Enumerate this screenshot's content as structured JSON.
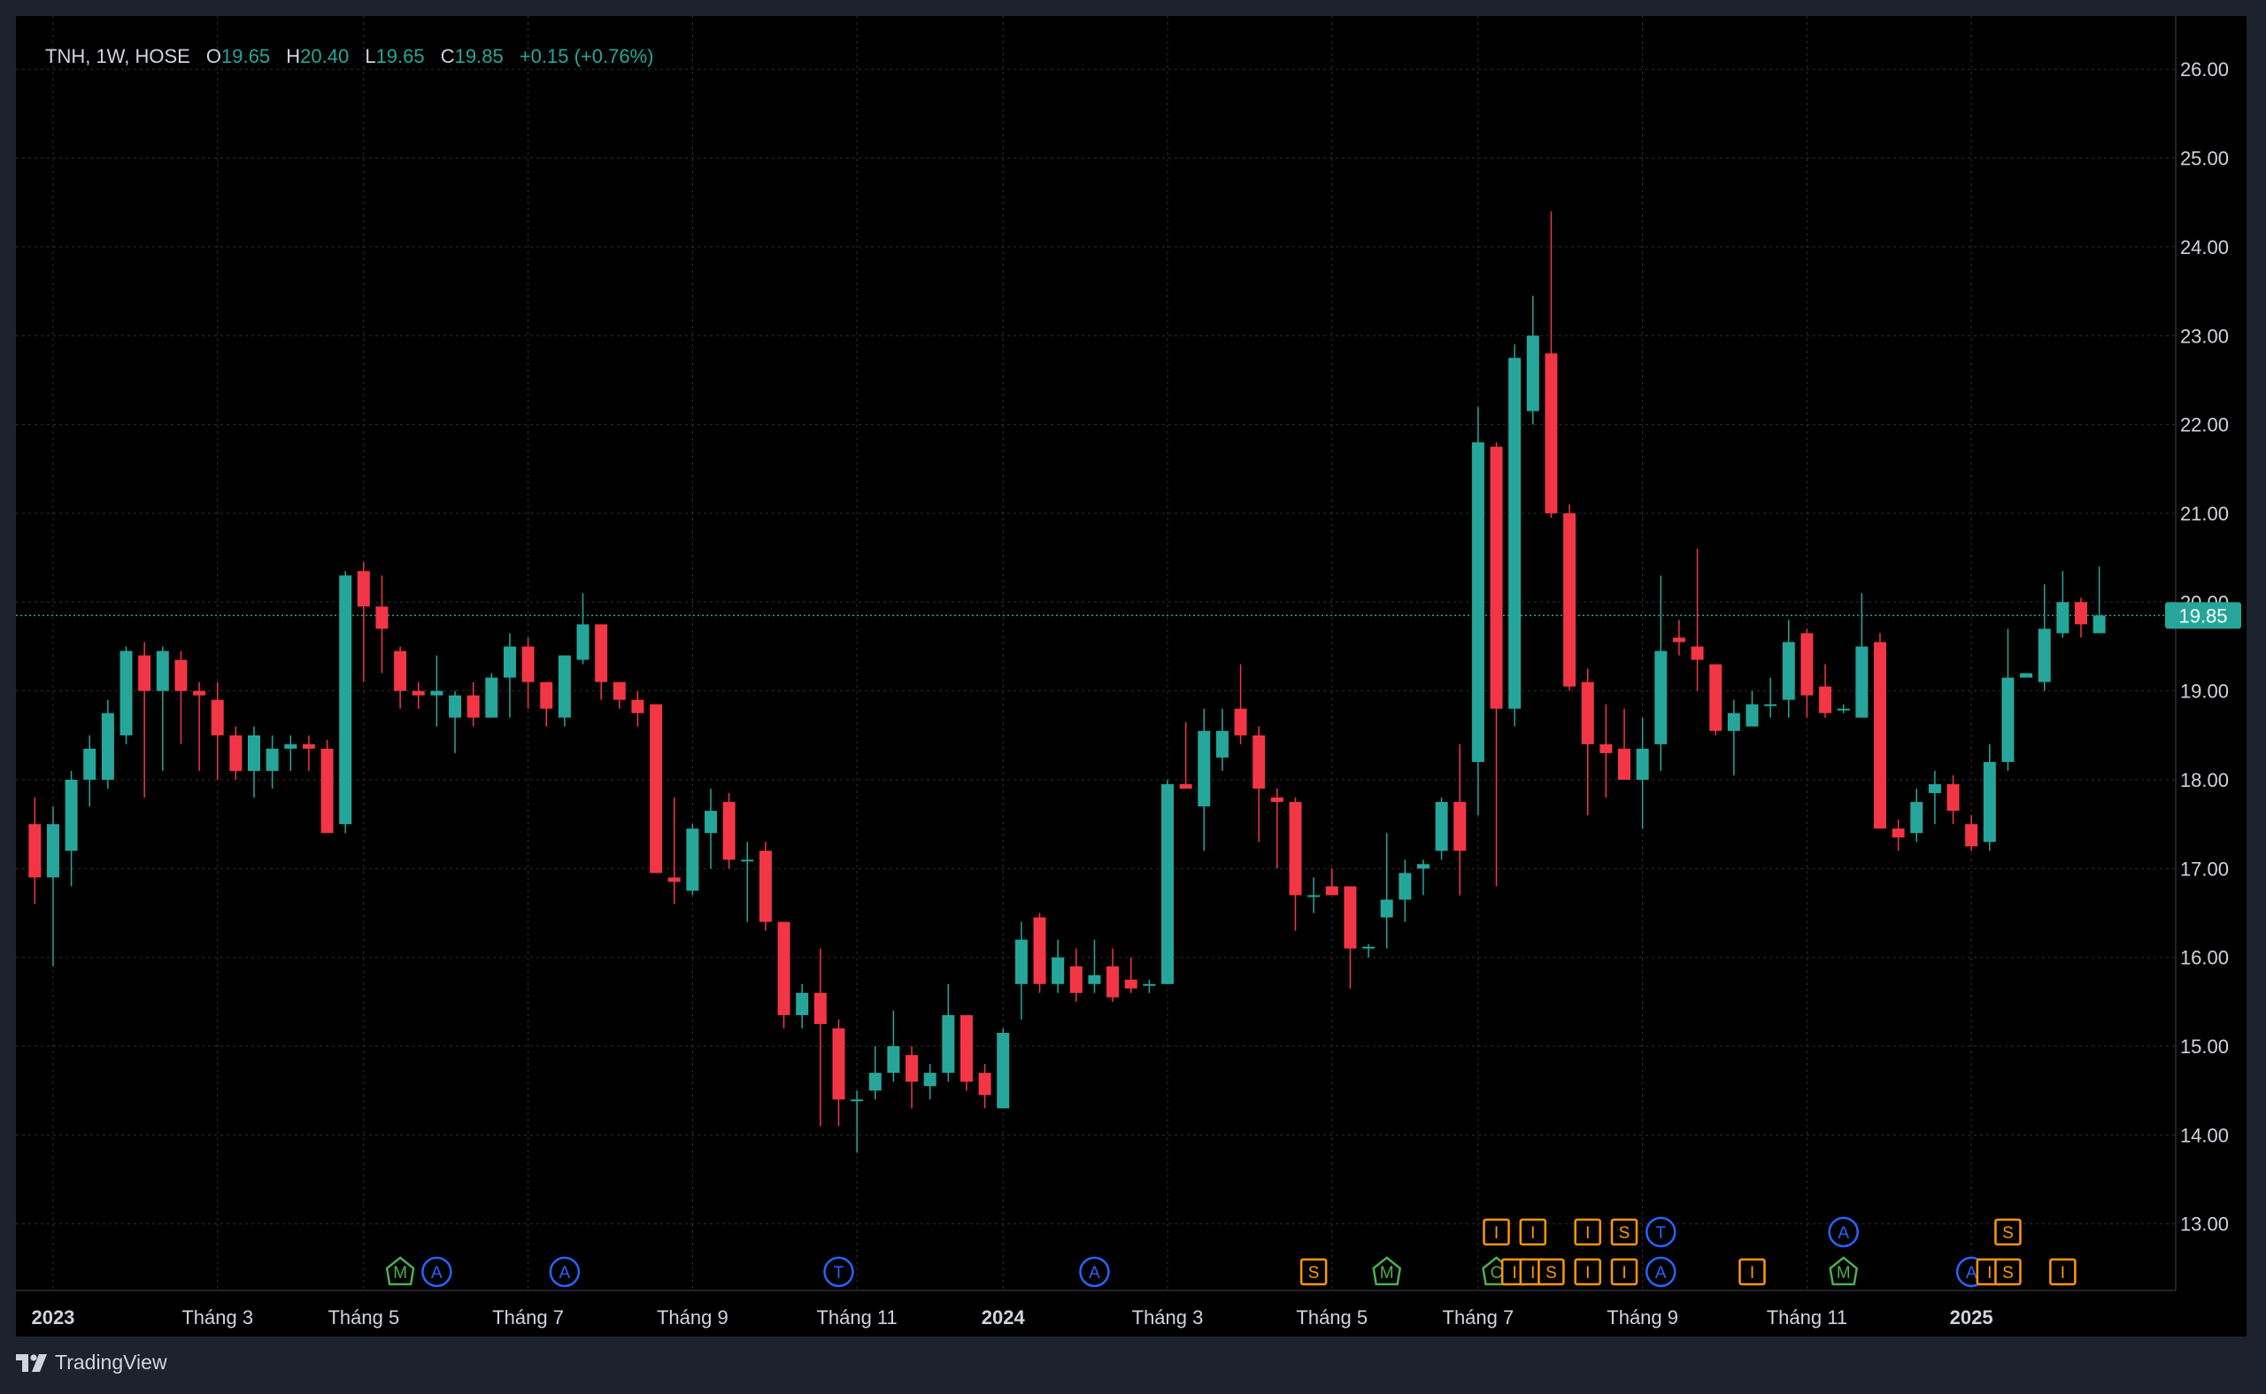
{
  "legend": {
    "symbol": "TNH, 1W, HOSE",
    "open_label": "O",
    "open": "19.65",
    "high_label": "H",
    "high": "20.40",
    "low_label": "L",
    "low": "19.65",
    "close_label": "C",
    "close": "19.85",
    "change": "+0.15 (+0.76%)"
  },
  "branding": {
    "name": "TradingView"
  },
  "colors": {
    "up": "#26a69a",
    "down": "#f23645",
    "grid": "#2a2e39",
    "text": "#d1d4dc",
    "background": "#000000",
    "price_line": "#26a69a"
  },
  "chart_data": {
    "type": "candlestick",
    "symbol": "TNH",
    "interval": "1W",
    "exchange": "HOSE",
    "current_price": 19.85,
    "current_price_label": "19.85",
    "ylim": [
      12.25,
      26.6
    ],
    "y_ticks": [
      "13.00",
      "14.00",
      "15.00",
      "16.00",
      "17.00",
      "18.00",
      "19.00",
      "20.00",
      "21.00",
      "22.00",
      "23.00",
      "24.00",
      "25.00",
      "26.00"
    ],
    "x_ticks": [
      {
        "label": "2023",
        "bold": true,
        "index": 1.5
      },
      {
        "label": "Tháng 3",
        "bold": false,
        "index": 10.5
      },
      {
        "label": "Tháng 5",
        "bold": false,
        "index": 18.5
      },
      {
        "label": "Tháng 7",
        "bold": false,
        "index": 27.5
      },
      {
        "label": "Tháng 9",
        "bold": false,
        "index": 36.5
      },
      {
        "label": "Tháng 11",
        "bold": false,
        "index": 45.5
      },
      {
        "label": "2024",
        "bold": true,
        "index": 53.5
      },
      {
        "label": "Tháng 3",
        "bold": false,
        "index": 62.5
      },
      {
        "label": "Tháng 5",
        "bold": false,
        "index": 71.5
      },
      {
        "label": "Tháng 7",
        "bold": false,
        "index": 79.5
      },
      {
        "label": "Tháng 9",
        "bold": false,
        "index": 88.5
      },
      {
        "label": "Tháng 11",
        "bold": false,
        "index": 97.5
      },
      {
        "label": "2025",
        "bold": true,
        "index": 106.5
      }
    ],
    "candles": [
      [
        17.5,
        17.8,
        16.6,
        16.9
      ],
      [
        16.9,
        17.7,
        15.9,
        17.5
      ],
      [
        17.2,
        18.1,
        16.8,
        18.0
      ],
      [
        18.0,
        18.5,
        17.7,
        18.35
      ],
      [
        18.0,
        18.9,
        17.9,
        18.75
      ],
      [
        18.5,
        19.5,
        18.4,
        19.45
      ],
      [
        19.4,
        19.55,
        17.8,
        19.0
      ],
      [
        19.0,
        19.5,
        18.1,
        19.45
      ],
      [
        19.35,
        19.45,
        18.4,
        19.0
      ],
      [
        19.0,
        19.1,
        18.1,
        18.95
      ],
      [
        18.9,
        19.1,
        18.0,
        18.5
      ],
      [
        18.5,
        18.6,
        18.0,
        18.1
      ],
      [
        18.1,
        18.6,
        17.8,
        18.5
      ],
      [
        18.1,
        18.5,
        17.9,
        18.35
      ],
      [
        18.35,
        18.5,
        18.1,
        18.4
      ],
      [
        18.4,
        18.5,
        18.1,
        18.35
      ],
      [
        18.35,
        18.45,
        17.4,
        17.4
      ],
      [
        17.5,
        20.35,
        17.4,
        20.3
      ],
      [
        20.35,
        20.45,
        19.1,
        19.95
      ],
      [
        19.95,
        20.3,
        19.2,
        19.7
      ],
      [
        19.45,
        19.5,
        18.8,
        19.0
      ],
      [
        19.0,
        19.1,
        18.8,
        18.95
      ],
      [
        18.95,
        19.4,
        18.6,
        19.0
      ],
      [
        18.7,
        19.0,
        18.3,
        18.95
      ],
      [
        18.95,
        19.1,
        18.6,
        18.7
      ],
      [
        18.7,
        19.2,
        18.7,
        19.15
      ],
      [
        19.15,
        19.65,
        18.7,
        19.5
      ],
      [
        19.5,
        19.6,
        18.8,
        19.1
      ],
      [
        19.1,
        19.1,
        18.6,
        18.8
      ],
      [
        18.7,
        19.4,
        18.6,
        19.4
      ],
      [
        19.35,
        20.1,
        19.3,
        19.75
      ],
      [
        19.75,
        19.75,
        18.9,
        19.1
      ],
      [
        19.1,
        19.1,
        18.8,
        18.9
      ],
      [
        18.9,
        19.0,
        18.6,
        18.75
      ],
      [
        18.85,
        18.85,
        16.95,
        16.95
      ],
      [
        16.9,
        17.8,
        16.6,
        16.85
      ],
      [
        16.75,
        17.5,
        16.7,
        17.45
      ],
      [
        17.4,
        17.9,
        17.0,
        17.65
      ],
      [
        17.75,
        17.85,
        17.0,
        17.1
      ],
      [
        17.1,
        17.3,
        16.4,
        17.1
      ],
      [
        17.2,
        17.3,
        16.3,
        16.4
      ],
      [
        16.4,
        16.4,
        15.2,
        15.35
      ],
      [
        15.35,
        15.7,
        15.2,
        15.6
      ],
      [
        15.6,
        16.1,
        14.1,
        15.25
      ],
      [
        15.2,
        15.3,
        14.1,
        14.4
      ],
      [
        14.4,
        14.5,
        13.8,
        14.4
      ],
      [
        14.5,
        15.0,
        14.4,
        14.7
      ],
      [
        14.7,
        15.4,
        14.6,
        15.0
      ],
      [
        14.9,
        15.0,
        14.3,
        14.6
      ],
      [
        14.55,
        14.8,
        14.4,
        14.7
      ],
      [
        14.7,
        15.7,
        14.6,
        15.35
      ],
      [
        15.35,
        15.35,
        14.5,
        14.6
      ],
      [
        14.7,
        14.8,
        14.3,
        14.45
      ],
      [
        14.3,
        15.2,
        14.3,
        15.15
      ],
      [
        15.7,
        16.4,
        15.3,
        16.2
      ],
      [
        16.45,
        16.5,
        15.6,
        15.7
      ],
      [
        15.7,
        16.2,
        15.6,
        16.0
      ],
      [
        15.9,
        16.1,
        15.5,
        15.6
      ],
      [
        15.7,
        16.2,
        15.6,
        15.8
      ],
      [
        15.9,
        16.1,
        15.5,
        15.55
      ],
      [
        15.75,
        16.0,
        15.6,
        15.65
      ],
      [
        15.7,
        15.75,
        15.6,
        15.7
      ],
      [
        15.7,
        18.0,
        15.7,
        17.95
      ],
      [
        17.95,
        18.65,
        17.9,
        17.9
      ],
      [
        17.7,
        18.8,
        17.2,
        18.55
      ],
      [
        18.25,
        18.8,
        18.1,
        18.55
      ],
      [
        18.8,
        19.3,
        18.4,
        18.5
      ],
      [
        18.5,
        18.6,
        17.3,
        17.9
      ],
      [
        17.8,
        17.9,
        17.0,
        17.75
      ],
      [
        17.75,
        17.8,
        16.3,
        16.7
      ],
      [
        16.7,
        16.9,
        16.5,
        16.7
      ],
      [
        16.8,
        17.0,
        16.7,
        16.7
      ],
      [
        16.8,
        16.8,
        15.65,
        16.1
      ],
      [
        16.1,
        16.15,
        16.0,
        16.12
      ],
      [
        16.45,
        17.4,
        16.1,
        16.65
      ],
      [
        16.65,
        17.1,
        16.4,
        16.95
      ],
      [
        17.0,
        17.1,
        16.7,
        17.05
      ],
      [
        17.2,
        17.8,
        17.1,
        17.75
      ],
      [
        17.75,
        18.4,
        16.7,
        17.2
      ],
      [
        18.2,
        22.2,
        17.6,
        21.8
      ],
      [
        21.75,
        21.8,
        16.8,
        18.8
      ],
      [
        18.8,
        22.9,
        18.6,
        22.75
      ],
      [
        22.15,
        23.45,
        22.0,
        23.0
      ],
      [
        22.8,
        24.4,
        20.95,
        21.0
      ],
      [
        21.0,
        21.1,
        19.0,
        19.05
      ],
      [
        19.1,
        19.25,
        17.6,
        18.4
      ],
      [
        18.4,
        18.85,
        17.8,
        18.3
      ],
      [
        18.35,
        18.8,
        18.0,
        18.0
      ],
      [
        18.0,
        18.7,
        17.45,
        18.35
      ],
      [
        18.4,
        20.3,
        18.1,
        19.45
      ],
      [
        19.6,
        19.8,
        19.4,
        19.55
      ],
      [
        19.5,
        20.6,
        19.0,
        19.35
      ],
      [
        19.3,
        19.3,
        18.5,
        18.55
      ],
      [
        18.55,
        18.9,
        18.05,
        18.75
      ],
      [
        18.6,
        19.0,
        18.6,
        18.85
      ],
      [
        18.85,
        19.15,
        18.7,
        18.85
      ],
      [
        18.9,
        19.8,
        18.7,
        19.55
      ],
      [
        19.65,
        19.7,
        18.7,
        18.95
      ],
      [
        19.05,
        19.3,
        18.7,
        18.75
      ],
      [
        18.8,
        18.85,
        18.75,
        18.8
      ],
      [
        18.7,
        20.1,
        18.7,
        19.5
      ],
      [
        19.55,
        19.65,
        17.5,
        17.45
      ],
      [
        17.45,
        17.55,
        17.2,
        17.35
      ],
      [
        17.4,
        17.9,
        17.3,
        17.75
      ],
      [
        17.85,
        18.1,
        17.5,
        17.95
      ],
      [
        17.95,
        18.05,
        17.5,
        17.65
      ],
      [
        17.5,
        17.6,
        17.2,
        17.25
      ],
      [
        17.3,
        18.4,
        17.2,
        18.2
      ],
      [
        18.2,
        19.7,
        18.1,
        19.15
      ],
      [
        19.15,
        19.2,
        19.15,
        19.2
      ],
      [
        19.1,
        20.2,
        19.0,
        19.7
      ],
      [
        19.65,
        20.35,
        19.6,
        20.0
      ],
      [
        20.0,
        20.05,
        19.6,
        19.75
      ],
      [
        19.65,
        20.4,
        19.65,
        19.85
      ]
    ],
    "event_markers": [
      {
        "label": "M",
        "type": "pentagon",
        "color": "#4caf50",
        "index": 20.5,
        "row": 0
      },
      {
        "label": "A",
        "type": "circle",
        "color": "#2962ff",
        "index": 22.5,
        "row": 0
      },
      {
        "label": "A",
        "type": "circle",
        "color": "#2962ff",
        "index": 29.5,
        "row": 0
      },
      {
        "label": "T",
        "type": "circle",
        "color": "#2962ff",
        "index": 44.5,
        "row": 0
      },
      {
        "label": "A",
        "type": "circle",
        "color": "#2962ff",
        "index": 58.5,
        "row": 0
      },
      {
        "label": "S",
        "type": "square",
        "color": "#ff9800",
        "index": 70.5,
        "row": 0
      },
      {
        "label": "M",
        "type": "pentagon",
        "color": "#4caf50",
        "index": 74.5,
        "row": 0
      },
      {
        "label": "C",
        "type": "pentagon",
        "color": "#4caf50",
        "index": 80.5,
        "row": 0
      },
      {
        "label": "I",
        "type": "square",
        "color": "#ff9800",
        "index": 81.5,
        "row": 0
      },
      {
        "label": "I",
        "type": "square",
        "color": "#ff9800",
        "index": 82.5,
        "row": 0
      },
      {
        "label": "S",
        "type": "square",
        "color": "#ff9800",
        "index": 83.5,
        "row": 0
      },
      {
        "label": "I",
        "type": "square",
        "color": "#ff9800",
        "index": 85.5,
        "row": 0
      },
      {
        "label": "I",
        "type": "square",
        "color": "#ff9800",
        "index": 87.5,
        "row": 0
      },
      {
        "label": "A",
        "type": "circle",
        "color": "#2962ff",
        "index": 89.5,
        "row": 0
      },
      {
        "label": "I",
        "type": "square",
        "color": "#ff9800",
        "index": 94.5,
        "row": 0
      },
      {
        "label": "M",
        "type": "pentagon",
        "color": "#4caf50",
        "index": 99.5,
        "row": 0
      },
      {
        "label": "A",
        "type": "circle",
        "color": "#2962ff",
        "index": 106.5,
        "row": 0
      },
      {
        "label": "I",
        "type": "square",
        "color": "#ff9800",
        "index": 107.5,
        "row": 0
      },
      {
        "label": "S",
        "type": "square",
        "color": "#ff9800",
        "index": 108.5,
        "row": 0
      },
      {
        "label": "I",
        "type": "square",
        "color": "#ff9800",
        "index": 111.5,
        "row": 0
      },
      {
        "label": "I",
        "type": "square",
        "color": "#ff9800",
        "index": 80.5,
        "row": 1
      },
      {
        "label": "I",
        "type": "square",
        "color": "#ff9800",
        "index": 82.5,
        "row": 1
      },
      {
        "label": "I",
        "type": "square",
        "color": "#ff9800",
        "index": 85.5,
        "row": 1
      },
      {
        "label": "S",
        "type": "square",
        "color": "#ff9800",
        "index": 87.5,
        "row": 1
      },
      {
        "label": "T",
        "type": "circle",
        "color": "#2962ff",
        "index": 89.5,
        "row": 1
      },
      {
        "label": "A",
        "type": "circle",
        "color": "#2962ff",
        "index": 99.5,
        "row": 1
      },
      {
        "label": "S",
        "type": "square",
        "color": "#ff9800",
        "index": 108.5,
        "row": 1
      }
    ]
  }
}
